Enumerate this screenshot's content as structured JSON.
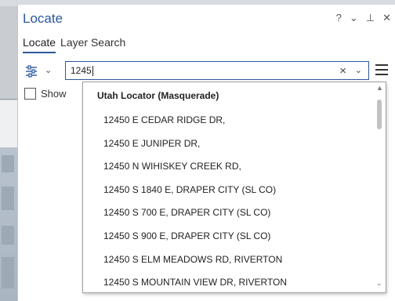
{
  "pane": {
    "title": "Locate",
    "controls": {
      "help": "?",
      "options": "⌄",
      "pin": "⊥",
      "close": "✕"
    }
  },
  "tabs": [
    {
      "label": "Locate",
      "active": true
    },
    {
      "label": "Layer Search",
      "active": false
    }
  ],
  "search": {
    "value": "1245",
    "clear": "×",
    "dropdown": "⌄",
    "options_chevron": "⌄"
  },
  "show_option": {
    "label": "Show"
  },
  "suggestions": {
    "header": "Utah Locator (Masquerade)",
    "items": [
      "12450 E CEDAR RIDGE DR,",
      "12450 E JUNIPER DR,",
      "12450 N WIHISKEY CREEK RD,",
      "12450 S 1840 E, DRAPER CITY (SL CO)",
      "12450 S 700 E, DRAPER CITY (SL CO)",
      "12450 S 900 E, DRAPER CITY (SL CO)",
      "12450 S ELM MEADOWS RD, RIVERTON",
      "12450 S MOUNTAIN VIEW DR, RIVERTON"
    ],
    "scroll_up": "▲",
    "scroll_down": "⌄"
  },
  "colors": {
    "accent": "#2b579a"
  }
}
